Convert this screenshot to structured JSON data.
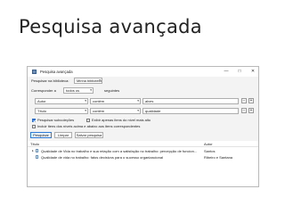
{
  "slide": {
    "title": "Pesquisa avançada"
  },
  "window": {
    "title": "Pesquisa avançada",
    "controls": {
      "minimize": "—",
      "maximize": "□",
      "close": "✕"
    }
  },
  "search": {
    "search_in_label": "Pesquisar na biblioteca:",
    "search_in_value": "Minha biblioteca",
    "match_label": "Corresponder a",
    "match_value": "todos os",
    "match_suffix": "seguintes",
    "conditions": [
      {
        "field": "Autor",
        "operator": "contém",
        "value": "alves"
      },
      {
        "field": "Título",
        "operator": "contém",
        "value": "qualidade"
      }
    ],
    "add_symbol": "+",
    "remove_symbol": "−",
    "options": [
      {
        "label": "Pesquisar subcoleções",
        "checked": true
      },
      {
        "label": "Exibir apenas itens do nível mais alto",
        "checked": false
      },
      {
        "label": "Incluir itens dos níveis acima e abaixo aos itens correspondentes",
        "checked": false
      }
    ],
    "buttons": {
      "search": "Pesquisar",
      "clear": "Limpar",
      "save": "Salvar pesquisa"
    }
  },
  "results": {
    "columns": {
      "title": "Título",
      "author": "Autor"
    },
    "rows": [
      {
        "title": "Qualidade de Vida no trabalho e sua relação com a satisfação no trabalho: percepção de funcion...",
        "author": "Santos"
      },
      {
        "title": "Qualidade de vida no trabalho: fatos decisivos para o sucesso organizacional",
        "author": "Ribeiro e Santana"
      }
    ]
  },
  "icons": {
    "dropdown": "chevron-down-icon",
    "expand": "triangle-right-icon",
    "document": "document-icon",
    "app": "app-icon"
  },
  "colors": {
    "accent": "#2f7bd6",
    "checkbox_on": "#2d6fce"
  }
}
